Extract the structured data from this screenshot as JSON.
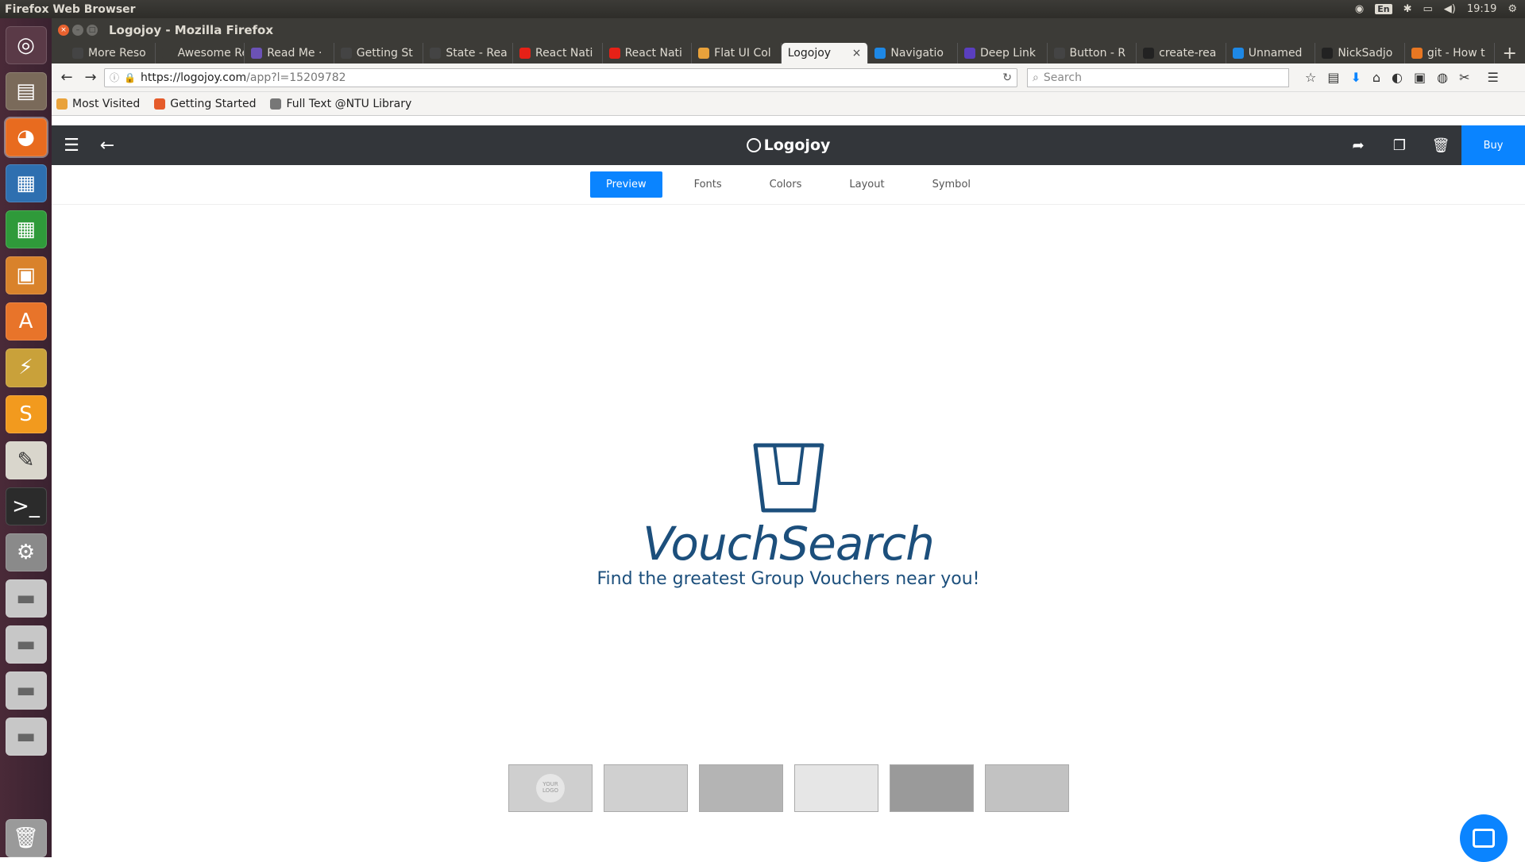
{
  "os": {
    "app_name": "Firefox Web Browser",
    "time": "19:19",
    "lang": "En"
  },
  "window": {
    "title": "Logojoy - Mozilla Firefox"
  },
  "tabs": [
    {
      "label": "More Reso",
      "fav": "#444"
    },
    {
      "label": "Awesome Re",
      "fav": "#3c3b37"
    },
    {
      "label": "Read Me ·",
      "fav": "#6b52b6"
    },
    {
      "label": "Getting St",
      "fav": "#444"
    },
    {
      "label": "State - Rea",
      "fav": "#444"
    },
    {
      "label": "React Nati",
      "fav": "#e62117"
    },
    {
      "label": "React Nati",
      "fav": "#e62117"
    },
    {
      "label": "Flat UI Col",
      "fav": "#e9a23b"
    },
    {
      "label": "Logojoy",
      "fav": "",
      "active": true
    },
    {
      "label": "Navigatio",
      "fav": "#1e88e5"
    },
    {
      "label": "Deep Link",
      "fav": "#5a3fc0"
    },
    {
      "label": "Button - R",
      "fav": "#444"
    },
    {
      "label": "create-rea",
      "fav": "#222"
    },
    {
      "label": "Unnamed",
      "fav": "#1e88e5"
    },
    {
      "label": "NickSadjo",
      "fav": "#222"
    },
    {
      "label": "git - How t",
      "fav": "#e87722"
    }
  ],
  "nav": {
    "url_host": "https://logojoy.com",
    "url_path": "/app?l=15209782",
    "search_placeholder": "Search"
  },
  "bookmarks": [
    {
      "label": "Most Visited",
      "color": "#e9a23b"
    },
    {
      "label": "Getting Started",
      "color": "#e55b2a"
    },
    {
      "label": "Full Text @NTU Library",
      "color": "#777"
    }
  ],
  "app": {
    "brand": "Logojoy",
    "buy_label": "Buy",
    "tabs": [
      "Preview",
      "Fonts",
      "Colors",
      "Layout",
      "Symbol"
    ],
    "logo_name": "VouchSearch",
    "tagline": "Find the greatest Group Vouchers near you!",
    "mockup_1_text": "YOUR LOGO",
    "logo_color": "#1c4f7c",
    "accent_color": "#0a84ff"
  }
}
